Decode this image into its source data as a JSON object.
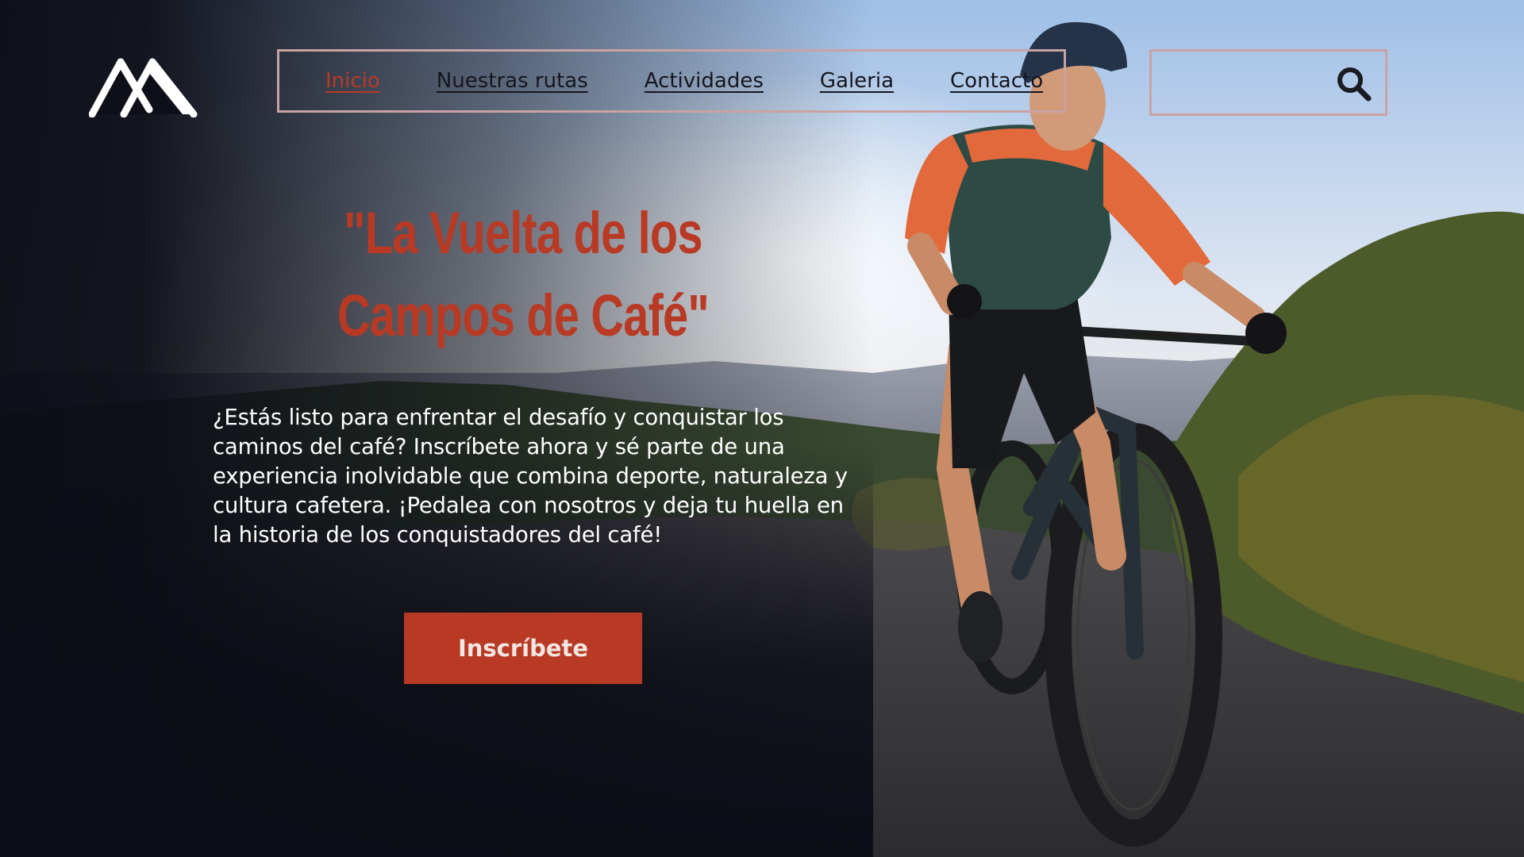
{
  "header": {
    "logo_icon": "mountain-logo-icon",
    "nav": [
      {
        "label": "Inicio",
        "active": true
      },
      {
        "label": "Nuestras rutas",
        "active": false
      },
      {
        "label": "Actividades",
        "active": false
      },
      {
        "label": "Galeria",
        "active": false
      },
      {
        "label": "Contacto",
        "active": false
      }
    ],
    "search_icon": "search-icon"
  },
  "hero": {
    "title": "\"La Vuelta de los Campos de Café\"",
    "text": "¿Estás listo para enfrentar el desafío y conquistar los caminos del café? Inscríbete ahora y sé parte de una experiencia inolvidable que combina deporte, naturaleza y cultura cafetera. ¡Pedalea con nosotros y deja tu huella en la historia de los conquistadores del café!",
    "cta_label": "Inscríbete"
  },
  "colors": {
    "accent": "#b83a24",
    "nav_border": "#c9a3a3",
    "dark_bg": "#0e0f18",
    "text_light": "#ffffff"
  }
}
